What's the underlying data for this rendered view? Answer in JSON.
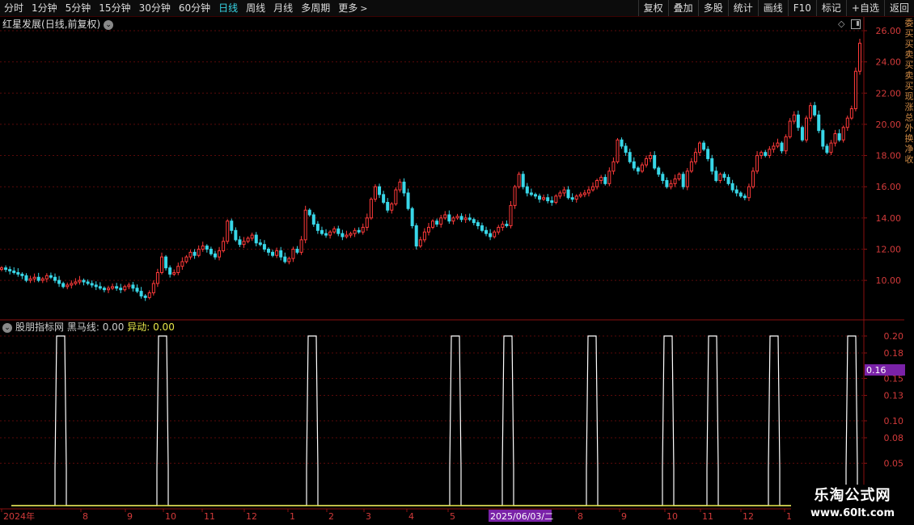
{
  "toolbar": {
    "left_items": [
      {
        "label": "分时",
        "active": false
      },
      {
        "label": "1分钟",
        "active": false
      },
      {
        "label": "5分钟",
        "active": false
      },
      {
        "label": "15分钟",
        "active": false
      },
      {
        "label": "30分钟",
        "active": false
      },
      {
        "label": "60分钟",
        "active": false
      },
      {
        "label": "日线",
        "active": true
      },
      {
        "label": "周线",
        "active": false
      },
      {
        "label": "月线",
        "active": false
      },
      {
        "label": "多周期",
        "active": false
      },
      {
        "label": "更多",
        "active": false
      }
    ],
    "right_items": [
      "复权",
      "叠加",
      "多股",
      "统计",
      "画线",
      "F10",
      "标记",
      "+自选",
      "返回"
    ]
  },
  "chart": {
    "stock_name": "红星发展",
    "period_label": "(日线,前复权)",
    "y_ticks": [
      "26.00",
      "24.00",
      "22.00",
      "20.00",
      "18.00",
      "16.00",
      "14.00",
      "12.00",
      "10.00"
    ]
  },
  "indicator": {
    "source_label": "股朋指标网",
    "line_label": "黑马线: 0.00",
    "abnormal_label": "异动: 0.00",
    "y_ticks": [
      "0.20",
      "0.18",
      "0.15",
      "0.13",
      "0.10",
      "0.08",
      "0.05"
    ],
    "highlight_value": "0.16",
    "highlight_color": "#7a22a8"
  },
  "x_axis": {
    "labels": [
      "2024年",
      "8",
      "9",
      "10",
      "11",
      "12",
      "1",
      "2",
      "3",
      "4",
      "5",
      "2025/06/03/二",
      "8",
      "9",
      "10",
      "11",
      "12",
      "1"
    ],
    "highlight_label": "2025/06/03/二"
  },
  "right_strip_text": "委 买买卖买卖买 现涨总外 换净收",
  "watermark": {
    "line1": "乐淘公式网",
    "line2": "www.60lt.com"
  },
  "colors": {
    "up": "#ff3a3a",
    "down": "#38d7e8",
    "grid": "#5a0a0a",
    "axis_text": "#d23a3a",
    "indicator_line": "#ffffff",
    "baseline": "#e8e84a",
    "active_tab": "#38d7e8"
  },
  "chart_data": {
    "type": "candlestick",
    "price_axis_range": [
      8.0,
      27.0
    ],
    "closes": [
      10.8,
      10.7,
      10.6,
      10.5,
      10.4,
      10.3,
      10.0,
      10.1,
      10.2,
      10.0,
      10.1,
      10.3,
      10.2,
      10.0,
      9.8,
      9.6,
      9.7,
      9.8,
      9.9,
      10.0,
      9.9,
      9.8,
      9.7,
      9.6,
      9.5,
      9.4,
      9.5,
      9.6,
      9.5,
      9.4,
      9.6,
      9.7,
      9.5,
      9.3,
      9.0,
      8.9,
      9.2,
      9.8,
      10.5,
      11.5,
      10.8,
      10.4,
      10.5,
      10.9,
      11.2,
      11.5,
      11.8,
      11.6,
      12.0,
      12.2,
      12.0,
      11.7,
      11.5,
      11.9,
      12.5,
      13.8,
      13.2,
      12.6,
      12.3,
      12.5,
      12.7,
      12.9,
      12.4,
      12.3,
      12.0,
      11.8,
      11.6,
      11.9,
      11.5,
      11.2,
      11.4,
      12.0,
      11.8,
      12.6,
      14.5,
      14.2,
      13.6,
      13.2,
      13.0,
      12.9,
      13.1,
      13.3,
      13.0,
      12.8,
      12.9,
      13.0,
      13.2,
      13.1,
      13.4,
      14.0,
      15.2,
      16.0,
      15.5,
      15.0,
      14.5,
      14.9,
      15.8,
      16.3,
      15.6,
      14.6,
      13.5,
      12.2,
      12.6,
      13.1,
      13.4,
      13.8,
      13.6,
      14.0,
      14.2,
      13.8,
      14.0,
      14.1,
      13.9,
      14.0,
      13.9,
      13.7,
      13.5,
      13.2,
      13.0,
      12.8,
      13.1,
      13.4,
      13.6,
      13.5,
      14.8,
      16.0,
      16.8,
      16.0,
      15.6,
      15.5,
      15.4,
      15.2,
      15.3,
      15.1,
      15.0,
      15.4,
      15.6,
      15.8,
      15.3,
      15.2,
      15.4,
      15.5,
      15.6,
      15.8,
      16.0,
      16.4,
      16.6,
      16.2,
      17.0,
      17.6,
      19.0,
      18.6,
      18.2,
      17.6,
      17.2,
      17.0,
      17.4,
      17.8,
      18.0,
      17.2,
      16.8,
      16.4,
      16.0,
      16.2,
      16.5,
      16.8,
      16.0,
      17.0,
      17.6,
      18.2,
      18.8,
      18.4,
      17.8,
      17.0,
      16.4,
      16.8,
      16.6,
      16.2,
      15.8,
      15.6,
      15.4,
      15.3,
      16.0,
      17.0,
      18.0,
      18.2,
      18.0,
      18.4,
      18.6,
      18.8,
      18.3,
      19.2,
      20.2,
      20.6,
      19.8,
      19.0,
      20.4,
      21.2,
      20.6,
      19.6,
      18.6,
      18.2,
      18.8,
      19.4,
      19.0,
      19.8,
      20.4,
      21.0,
      23.4,
      25.2
    ]
  }
}
